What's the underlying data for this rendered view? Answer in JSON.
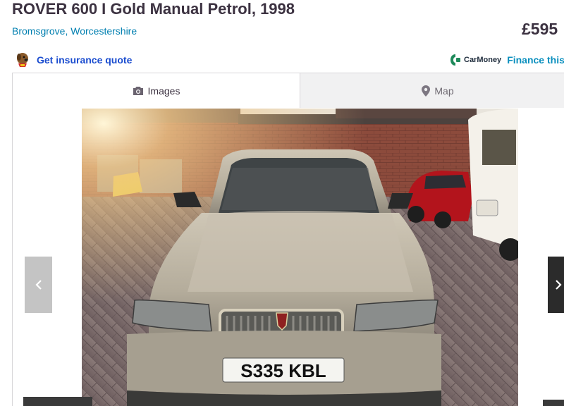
{
  "listing": {
    "title": "ROVER 600 I Gold Manual Petrol, 1998",
    "location": "Bromsgrove, Worcestershire",
    "price": "£595"
  },
  "links": {
    "insurance_label": "Get insurance quote",
    "carmoney_brand": "CarMoney",
    "finance_label": "Finance this car"
  },
  "tabs": [
    {
      "label": "Images",
      "icon": "camera-icon",
      "active": true
    },
    {
      "label": "Map",
      "icon": "map-pin-icon",
      "active": false
    }
  ],
  "photo": {
    "plate": "S335 KBL"
  },
  "colors": {
    "title": "#3c3241",
    "location_link": "#007fb0",
    "insurance_link": "#1a4ccf",
    "finance_link": "#0a8fbe"
  }
}
